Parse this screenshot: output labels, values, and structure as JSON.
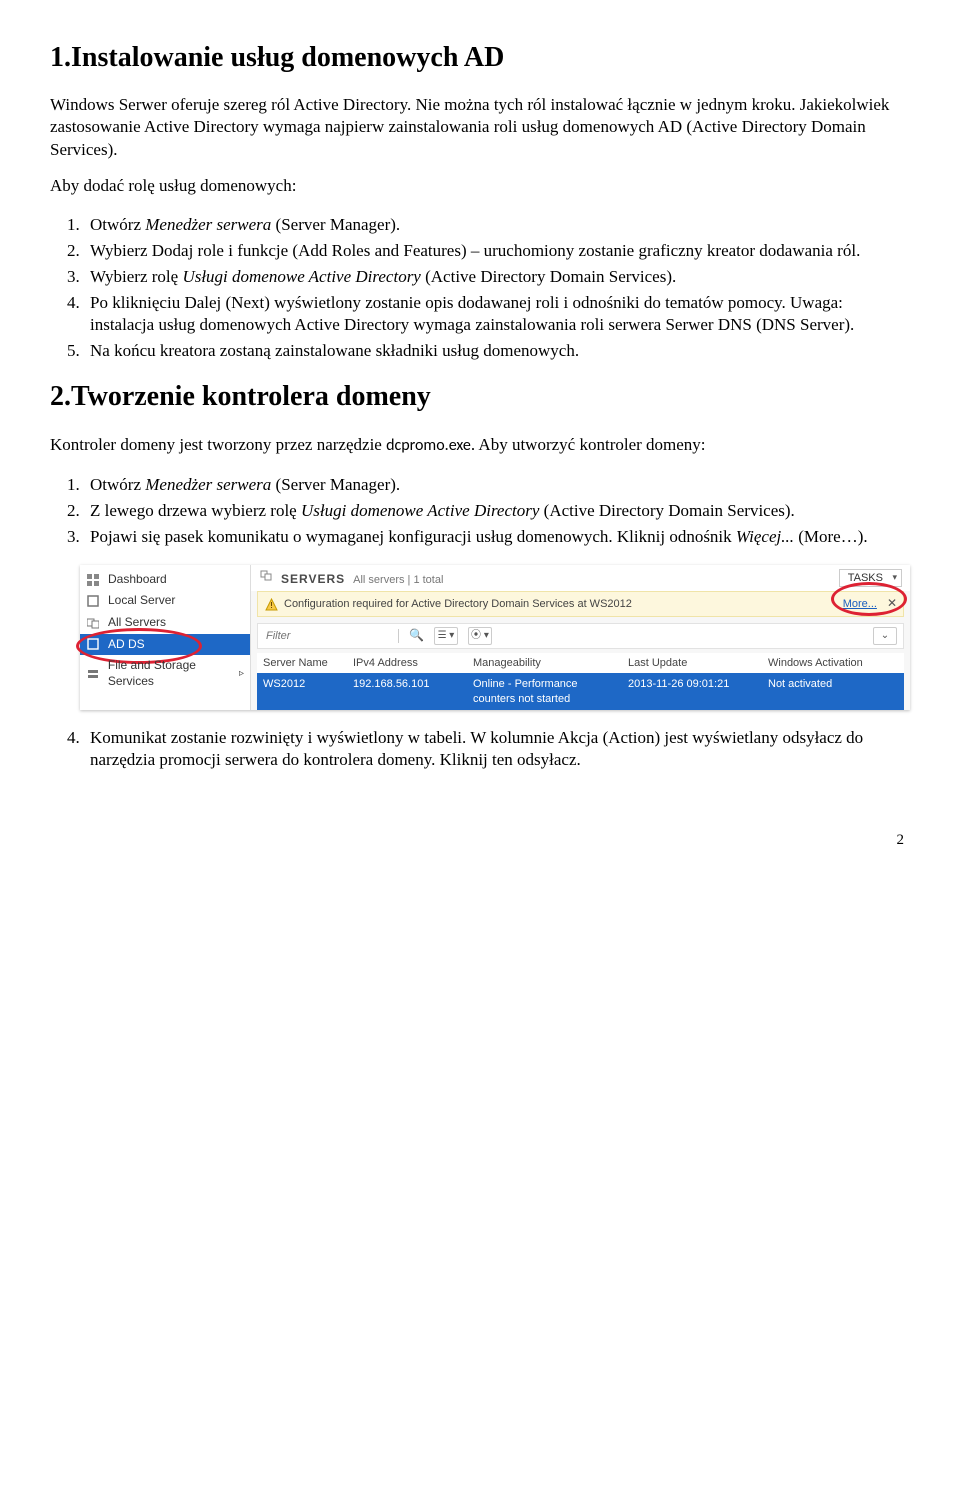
{
  "heading1": "1.Instalowanie usług domenowych AD",
  "para1a": "Windows Serwer oferuje szereg ról Active Directory. Nie można tych ról instalować łącznie w jednym kroku. Jakiekolwiek zastosowanie Active Directory wymaga najpierw zainstalowania roli usług domenowych AD (Active Directory Domain Services).",
  "para1b": "Aby dodać rolę usług domenowych:",
  "list1": {
    "i1a": "Otwórz ",
    "i1b": "Menedżer serwera",
    "i1c": " (Server Manager).",
    "i2a": "Wybierz Dodaj role i funkcje (Add Roles and Features) – uruchomiony zostanie graficzny kreator dodawania ról.",
    "i3a": "Wybierz rolę ",
    "i3b": "Usługi domenowe Active Directory",
    "i3c": " (Active Directory Domain Services).",
    "i4a": "Po kliknięciu Dalej (Next) wyświetlony zostanie opis dodawanej roli i odnośniki do tematów pomocy. Uwaga: instalacja usług domenowych Active Directory wymaga zainstalowania roli serwera Serwer DNS (DNS Server).",
    "i5a": "Na końcu kreatora zostaną zainstalowane składniki usług domenowych."
  },
  "heading2": "2.Tworzenie kontrolera domeny",
  "para2a_pre": "Kontroler domeny jest tworzony przez narzędzie ",
  "para2a_tool": "dcpromo.exe",
  "para2a_post": ". Aby utworzyć kontroler domeny:",
  "list2": {
    "i1a": "Otwórz ",
    "i1b": "Menedżer serwera",
    "i1c": " (Server Manager).",
    "i2a": "Z lewego drzewa wybierz rolę ",
    "i2b": "Usługi domenowe Active Directory",
    "i2c": " (Active Directory Domain Services).",
    "i3a": "Pojawi się pasek komunikatu o wymaganej konfiguracji usług domenowych. Kliknij odnośnik ",
    "i3b": "Więcej...",
    "i3c": " (More…)."
  },
  "screenshot": {
    "sidebar": {
      "dashboard": "Dashboard",
      "local": "Local Server",
      "all": "All Servers",
      "adds": "AD DS",
      "files": "File and Storage Services"
    },
    "header": {
      "title": "SERVERS",
      "subtitle": "All servers | 1 total",
      "tasks": "TASKS"
    },
    "warning": {
      "text": "Configuration required for Active Directory Domain Services at WS2012",
      "more": "More..."
    },
    "filter": {
      "placeholder": "Filter"
    },
    "table": {
      "h1": "Server Name",
      "h2": "IPv4 Address",
      "h3": "Manageability",
      "h4": "Last Update",
      "h5": "Windows Activation",
      "r1c1": "WS2012",
      "r1c2": "192.168.56.101",
      "r1c3": "Online - Performance counters not started",
      "r1c4": "2013-11-26 09:01:21",
      "r1c5": "Not activated"
    }
  },
  "list3": {
    "i4": "Komunikat zostanie rozwinięty i wyświetlony w tabeli. W kolumnie Akcja (Action) jest wyświetlany odsyłacz do narzędzia promocji serwera do kontrolera domeny. Kliknij ten odsyłacz."
  },
  "page_number": "2"
}
